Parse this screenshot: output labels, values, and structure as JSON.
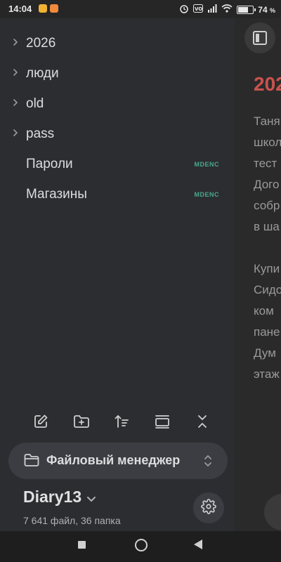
{
  "status_bar": {
    "time": "14:04",
    "battery_percent": "74",
    "battery_unit": "%",
    "battery_level": 0.74
  },
  "file_tree": {
    "items": [
      {
        "label": "2026",
        "collapsible": true,
        "tag": ""
      },
      {
        "label": "люди",
        "collapsible": true,
        "tag": ""
      },
      {
        "label": "old",
        "collapsible": true,
        "tag": ""
      },
      {
        "label": "pass",
        "collapsible": true,
        "tag": ""
      },
      {
        "label": "Пароли",
        "collapsible": false,
        "tag": "MDENC"
      },
      {
        "label": "Магазины",
        "collapsible": false,
        "tag": "MDENC"
      }
    ]
  },
  "toolbar": {
    "icons": [
      "new-note-icon",
      "new-folder-icon",
      "sort-icon",
      "auto-reveal-icon",
      "collapse-all-icon"
    ]
  },
  "file_manager": {
    "label": "Файловый менеджер"
  },
  "vault": {
    "name": "Diary13",
    "stats": "7 641 файл, 36 папка"
  },
  "editor_background": {
    "title": "202",
    "lines": [
      "Таня",
      "школ",
      "тест",
      "Дого",
      "собр",
      "в ша",
      "",
      "Купи",
      "Сидо",
      "ком",
      "пане",
      "Дум",
      "этаж"
    ]
  },
  "colors": {
    "drawer_bg": "#2b2d31",
    "tag_color": "#4aa88a",
    "title_color": "#c9524e"
  }
}
